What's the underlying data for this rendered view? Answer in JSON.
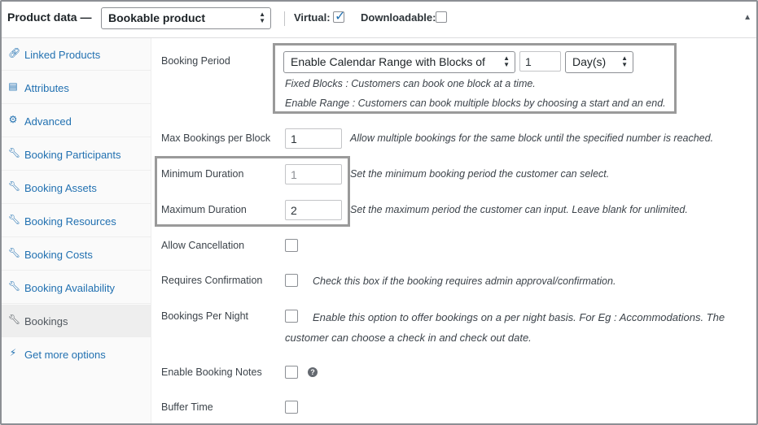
{
  "header": {
    "title": "Product data —",
    "product_type": "Bookable product",
    "virtual_label": "Virtual:",
    "virtual_checked": true,
    "downloadable_label": "Downloadable:",
    "downloadable_checked": false
  },
  "sidebar": {
    "items": [
      {
        "label": "Linked Products",
        "icon": "link-icon",
        "active": false
      },
      {
        "label": "Attributes",
        "icon": "list-icon",
        "active": false
      },
      {
        "label": "Advanced",
        "icon": "gear-icon",
        "active": false
      },
      {
        "label": "Booking Participants",
        "icon": "wrench-icon",
        "active": false
      },
      {
        "label": "Booking Assets",
        "icon": "wrench-icon",
        "active": false
      },
      {
        "label": "Booking Resources",
        "icon": "wrench-icon",
        "active": false
      },
      {
        "label": "Booking Costs",
        "icon": "wrench-icon",
        "active": false
      },
      {
        "label": "Booking Availability",
        "icon": "wrench-icon",
        "active": false
      },
      {
        "label": "Bookings",
        "icon": "wrench-icon",
        "active": true
      },
      {
        "label": "Get more options",
        "icon": "plug-icon",
        "active": false
      }
    ]
  },
  "fields": {
    "booking_period": {
      "label": "Booking Period",
      "mode": "Enable Calendar Range with Blocks of",
      "block_value": "1",
      "unit": "Day(s)",
      "help_fixed": "Fixed Blocks : Customers can book one block at a time.",
      "help_range": "Enable Range : Customers can book multiple blocks by choosing a start and an end."
    },
    "max_bookings": {
      "label": "Max Bookings per Block",
      "value": "1",
      "desc": "Allow multiple bookings for the same block until the specified number is reached."
    },
    "min_duration": {
      "label": "Minimum Duration",
      "value": "1",
      "desc": "Set the minimum booking period the customer can select."
    },
    "max_duration": {
      "label": "Maximum Duration",
      "value": "2",
      "desc": "Set the maximum period the customer can input. Leave blank for unlimited."
    },
    "allow_cancellation": {
      "label": "Allow Cancellation",
      "checked": false
    },
    "requires_confirmation": {
      "label": "Requires Confirmation",
      "checked": false,
      "desc": "Check this box if the booking requires admin approval/confirmation."
    },
    "per_night": {
      "label": "Bookings Per Night",
      "checked": false,
      "desc_line1": "Enable this option to offer bookings on a per night basis. For Eg : Accommodations. The",
      "desc_line2": "customer can choose a check in and check out date."
    },
    "booking_notes": {
      "label": "Enable Booking Notes",
      "checked": false,
      "help": "?"
    },
    "buffer_time": {
      "label": "Buffer Time",
      "checked": false
    }
  },
  "colors": {
    "link": "#2271b1",
    "highlight_border": "#9a9a9a"
  }
}
